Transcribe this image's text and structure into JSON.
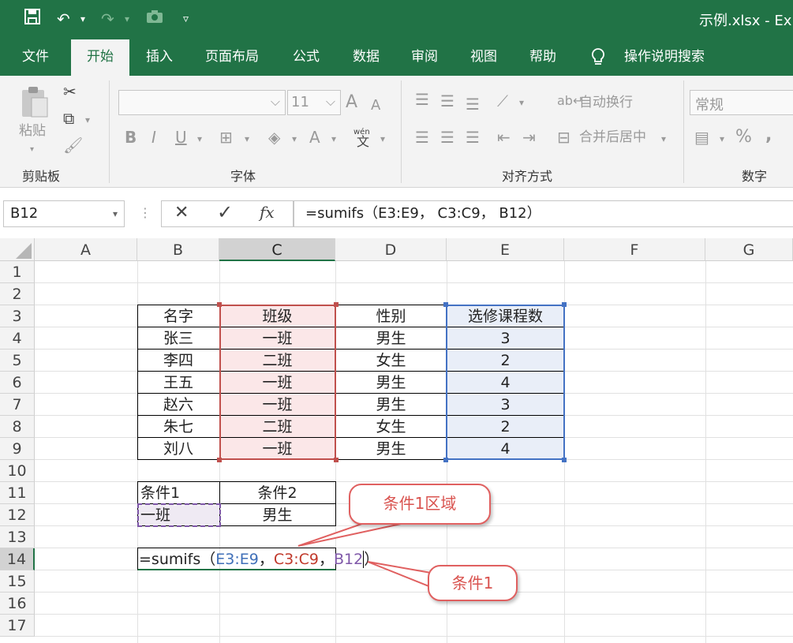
{
  "window": {
    "title": "示例.xlsx  -  Ex"
  },
  "quick_access": {
    "save_icon": "save-icon",
    "undo_icon": "undo-icon",
    "redo_icon": "redo-icon",
    "camera_icon": "camera-icon",
    "customize_icon": "customize-icon"
  },
  "tabs": [
    "文件",
    "开始",
    "插入",
    "页面布局",
    "公式",
    "数据",
    "审阅",
    "视图",
    "帮助",
    "操作说明搜索"
  ],
  "ribbon": {
    "clipboard": {
      "paste_label": "粘贴",
      "group_label": "剪贴板"
    },
    "font": {
      "font_size": "11",
      "group_label": "字体",
      "bold": "B",
      "italic": "I",
      "underline": "U",
      "grow": "A",
      "shrink": "A",
      "color_a": "A",
      "wen": "wén",
      "wen_char": "文"
    },
    "alignment": {
      "wrap_label": "自动换行",
      "merge_label": "合并后居中",
      "group_label": "对齐方式"
    },
    "number": {
      "format_value": "常规",
      "group_label": "数字",
      "percent": "%",
      "comma": ","
    }
  },
  "formula_bar": {
    "name_box": "B12",
    "cancel": "✕",
    "enter": "✓",
    "fx": "fx",
    "formula": "=sumifs（E3:E9， C3:C9， B12）"
  },
  "columns": [
    "A",
    "B",
    "C",
    "D",
    "E",
    "F",
    "G"
  ],
  "rows": [
    "1",
    "2",
    "3",
    "4",
    "5",
    "6",
    "7",
    "8",
    "9",
    "10",
    "11",
    "12",
    "13",
    "14",
    "15",
    "16",
    "17"
  ],
  "table": {
    "headers": [
      "名字",
      "班级",
      "性别",
      "选修课程数"
    ],
    "rows": [
      [
        "张三",
        "一班",
        "男生",
        "3"
      ],
      [
        "李四",
        "二班",
        "女生",
        "2"
      ],
      [
        "王五",
        "一班",
        "男生",
        "4"
      ],
      [
        "赵六",
        "一班",
        "男生",
        "3"
      ],
      [
        "朱七",
        "二班",
        "女生",
        "2"
      ],
      [
        "刘八",
        "一班",
        "男生",
        "4"
      ]
    ]
  },
  "criteria": {
    "header1": "条件1",
    "header2": "条件2",
    "value1": "一班",
    "value2": "男生"
  },
  "editing_formula": {
    "prefix": "=sumifs（",
    "ref1": "E3:E9",
    "sep1": "，",
    "ref2": "C3:C9",
    "sep2": "，",
    "ref3": "B12",
    "suffix": "）"
  },
  "callouts": {
    "range_label": "条件1区域",
    "criteria_label": "条件1"
  },
  "colors": {
    "excel_green": "#217346",
    "ref1_color": "#3f6fb8",
    "ref2_color": "#c0392b",
    "ref3_color": "#7e57a8",
    "callout_border": "#e06060"
  }
}
